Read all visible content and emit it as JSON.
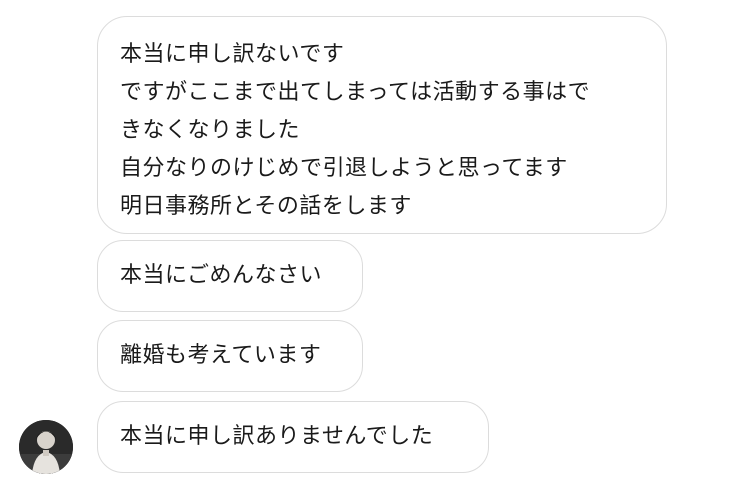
{
  "messages": [
    {
      "lines": [
        "本当に申し訳ないです",
        "ですがここまで出てしまっては活動する事はで",
        "きなくなりました",
        "自分なりのけじめで引退しようと思ってます",
        "明日事務所とその話をします"
      ]
    },
    {
      "text": "本当にごめんなさい"
    },
    {
      "text": "離婚も考えています"
    },
    {
      "text": "本当に申し訳ありませんでした"
    }
  ],
  "colors": {
    "bubble_border": "#dcdcdc",
    "bubble_background": "#ffffff",
    "text": "#1a1a1a"
  },
  "icons": {
    "sender_avatar": "profile-photo"
  }
}
